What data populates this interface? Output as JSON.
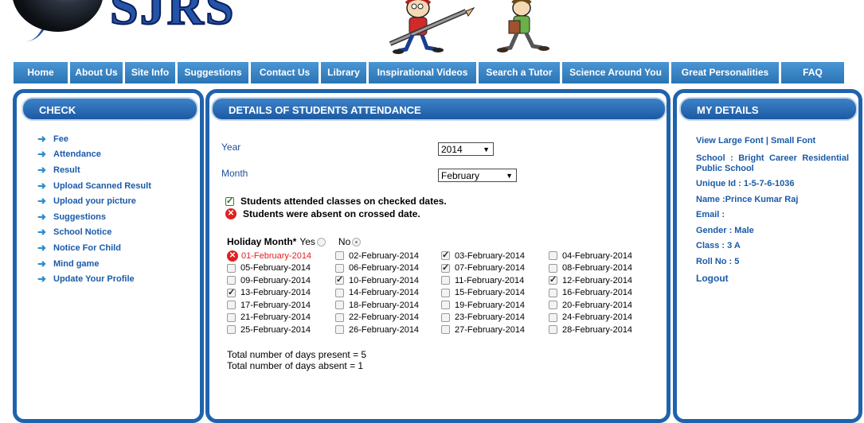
{
  "logo": {
    "text": "SJRS"
  },
  "nav": [
    {
      "label": "Home"
    },
    {
      "label": "About Us"
    },
    {
      "label": "Site Info"
    },
    {
      "label": "Suggestions"
    },
    {
      "label": "Contact Us"
    },
    {
      "label": "Library"
    },
    {
      "label": "Inspirational Videos"
    },
    {
      "label": "Search a Tutor"
    },
    {
      "label": "Science Around You"
    },
    {
      "label": "Great Personalities"
    },
    {
      "label": "FAQ"
    }
  ],
  "check": {
    "title": "CHECK",
    "items": [
      {
        "label": "Fee"
      },
      {
        "label": "Attendance"
      },
      {
        "label": "Result"
      },
      {
        "label": "Upload Scanned Result"
      },
      {
        "label": "Upload your picture"
      },
      {
        "label": "Suggestions"
      },
      {
        "label": "School Notice"
      },
      {
        "label": "Notice For Child"
      },
      {
        "label": "Mind game"
      },
      {
        "label": "Update Your Profile"
      }
    ]
  },
  "attendance": {
    "title": "DETAILS OF STUDENTS ATTENDANCE",
    "year_label": "Year",
    "year_value": "2014",
    "month_label": "Month",
    "month_value": "February",
    "legend_attended": "Students attended classes on checked dates.",
    "legend_absent": "Students were absent on crossed date.",
    "holiday_label": "Holiday Month",
    "holiday_required": "*",
    "holiday_yes": "Yes",
    "holiday_no": "No",
    "holiday_selected": "No",
    "dates": [
      {
        "label": "01-February-2014",
        "status": "absent"
      },
      {
        "label": "02-February-2014",
        "status": "none"
      },
      {
        "label": "03-February-2014",
        "status": "present"
      },
      {
        "label": "04-February-2014",
        "status": "none"
      },
      {
        "label": "05-February-2014",
        "status": "none"
      },
      {
        "label": "06-February-2014",
        "status": "none"
      },
      {
        "label": "07-February-2014",
        "status": "present"
      },
      {
        "label": "08-February-2014",
        "status": "none"
      },
      {
        "label": "09-February-2014",
        "status": "none"
      },
      {
        "label": "10-February-2014",
        "status": "present"
      },
      {
        "label": "11-February-2014",
        "status": "none"
      },
      {
        "label": "12-February-2014",
        "status": "present"
      },
      {
        "label": "13-February-2014",
        "status": "present"
      },
      {
        "label": "14-February-2014",
        "status": "none"
      },
      {
        "label": "15-February-2014",
        "status": "none"
      },
      {
        "label": "16-February-2014",
        "status": "none"
      },
      {
        "label": "17-February-2014",
        "status": "none"
      },
      {
        "label": "18-February-2014",
        "status": "none"
      },
      {
        "label": "19-February-2014",
        "status": "none"
      },
      {
        "label": "20-February-2014",
        "status": "none"
      },
      {
        "label": "21-February-2014",
        "status": "none"
      },
      {
        "label": "22-February-2014",
        "status": "none"
      },
      {
        "label": "23-February-2014",
        "status": "none"
      },
      {
        "label": "24-February-2014",
        "status": "none"
      },
      {
        "label": "25-February-2014",
        "status": "none"
      },
      {
        "label": "26-February-2014",
        "status": "none"
      },
      {
        "label": "27-February-2014",
        "status": "none"
      },
      {
        "label": "28-February-2014",
        "status": "none"
      }
    ],
    "total_present": "Total number of days present = 5",
    "total_absent": "Total number of days absent = 1"
  },
  "details": {
    "title": "MY DETAILS",
    "view_prefix": "View",
    "large_font": "Large Font",
    "separator": "|",
    "small_font": "Small Font",
    "school": "School : Bright Career Residential Public School",
    "unique_id": "Unique Id : 1-5-7-6-1036",
    "name": "Name :Prince Kumar Raj",
    "email": "Email :",
    "gender": "Gender : Male",
    "class": "Class : 3 A",
    "roll": "Roll No : 5",
    "logout": "Logout"
  },
  "colors": {
    "nav_bg": "#2a74b5",
    "panel_border": "#1e63ad",
    "link": "#1a5aa8",
    "absent_red": "#e02020"
  }
}
